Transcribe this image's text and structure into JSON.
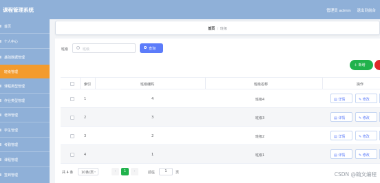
{
  "app": {
    "title": "课程管理系统",
    "admin": "管理员 admin",
    "logout": "退出到前台"
  },
  "sidebar": {
    "items": [
      {
        "label": "首页"
      },
      {
        "label": "个人中心"
      },
      {
        "label": "基础数据管理"
      },
      {
        "label": "班级管理"
      },
      {
        "label": "课程类型管理"
      },
      {
        "label": "作业类型管理"
      },
      {
        "label": "老师管理"
      },
      {
        "label": "学生管理"
      },
      {
        "label": "考勤管理"
      },
      {
        "label": "课程管理"
      },
      {
        "label": "签到管理"
      }
    ],
    "active_index": 3
  },
  "breadcrumb": {
    "home": "首页",
    "sep": "/",
    "current": "班级"
  },
  "search": {
    "label": "班级",
    "placeholder": "班级",
    "query_label": "查询"
  },
  "actions": {
    "add_label": "新增"
  },
  "table": {
    "headers": {
      "index": "索引",
      "code": "班级编码",
      "name": "班级名称",
      "ops": "操作"
    },
    "rows": [
      {
        "index": "1",
        "code": "4",
        "name": "班级4"
      },
      {
        "index": "2",
        "code": "3",
        "name": "班级3"
      },
      {
        "index": "3",
        "code": "2",
        "name": "班级2"
      },
      {
        "index": "4",
        "code": "1",
        "name": "班级1"
      }
    ],
    "op_detail": "详情",
    "op_edit": "修改"
  },
  "pagination": {
    "total": "共 4 条",
    "page_size": "10条/页",
    "current": "1",
    "goto": "前往",
    "goto_value": "1",
    "page_suffix": "页"
  },
  "watermark": "CSDN @翰文编程",
  "colors": {
    "sidebar": "#8fb0d8",
    "active": "#f39b2d",
    "primary": "#5c7cfa",
    "success": "#21b24c",
    "danger": "#e02a2a"
  }
}
